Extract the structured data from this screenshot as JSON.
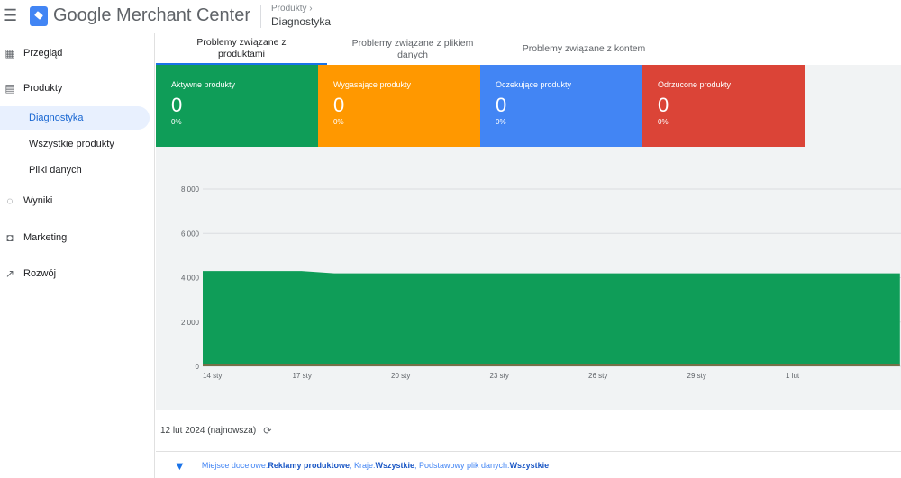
{
  "header": {
    "app_title": "Google Merchant Center",
    "breadcrumb_parent": "Produkty",
    "breadcrumb_current": "Diagnostyka"
  },
  "sidebar": {
    "items": [
      {
        "label": "Przegląd",
        "icon": "dashboard-icon"
      },
      {
        "label": "Produkty",
        "icon": "list-icon"
      },
      {
        "label": "Wyniki",
        "icon": "donut-chart-icon"
      },
      {
        "label": "Marketing",
        "icon": "shopping-bag-icon"
      },
      {
        "label": "Rozwój",
        "icon": "trending-up-icon"
      }
    ],
    "sub_items": [
      {
        "label": "Diagnostyka",
        "active": true
      },
      {
        "label": "Wszystkie produkty"
      },
      {
        "label": "Pliki danych"
      }
    ]
  },
  "tabs": [
    {
      "label": "Problemy związane z produktami",
      "active": true
    },
    {
      "label": "Problemy związane z plikiem danych"
    },
    {
      "label": "Problemy związane z kontem"
    }
  ],
  "cards": [
    {
      "label": "Aktywne produkty",
      "value": "0",
      "percent": "0%",
      "color": "#0f9d58"
    },
    {
      "label": "Wygasające produkty",
      "value": "0",
      "percent": "0%",
      "color": "#ff9800"
    },
    {
      "label": "Oczekujące produkty",
      "value": "0",
      "percent": "0%",
      "color": "#4285f4"
    },
    {
      "label": "Odrzucone produkty",
      "value": "0",
      "percent": "0%",
      "color": "#db4437"
    }
  ],
  "chart_data": {
    "type": "area",
    "y_ticks": [
      "0",
      "2 000",
      "4 000",
      "6 000",
      "8 000"
    ],
    "ylim": [
      0,
      8000
    ],
    "x_ticks": [
      "14 sty",
      "17 sty",
      "20 sty",
      "23 sty",
      "26 sty",
      "29 sty",
      "1 lut"
    ],
    "series": [
      {
        "name": "Aktywne produkty",
        "color": "#0f9d58",
        "day": [
          0,
          3,
          4,
          21.2
        ],
        "values": [
          4300,
          4300,
          4200,
          4200
        ]
      },
      {
        "name": "Odrzucone produkty",
        "color": "#db4437",
        "day": [
          0,
          21.2
        ],
        "values": [
          60,
          60
        ]
      }
    ]
  },
  "footer": {
    "date": "12 lut 2024 (najnowsza)",
    "filter_k1": "Miejsce docelowe: ",
    "filter_v1": "Reklamy produktowe",
    "filter_k2": "; Kraje: ",
    "filter_v2": "Wszystkie",
    "filter_k3": "; Podstawowy plik danych: ",
    "filter_v3": "Wszystkie"
  }
}
